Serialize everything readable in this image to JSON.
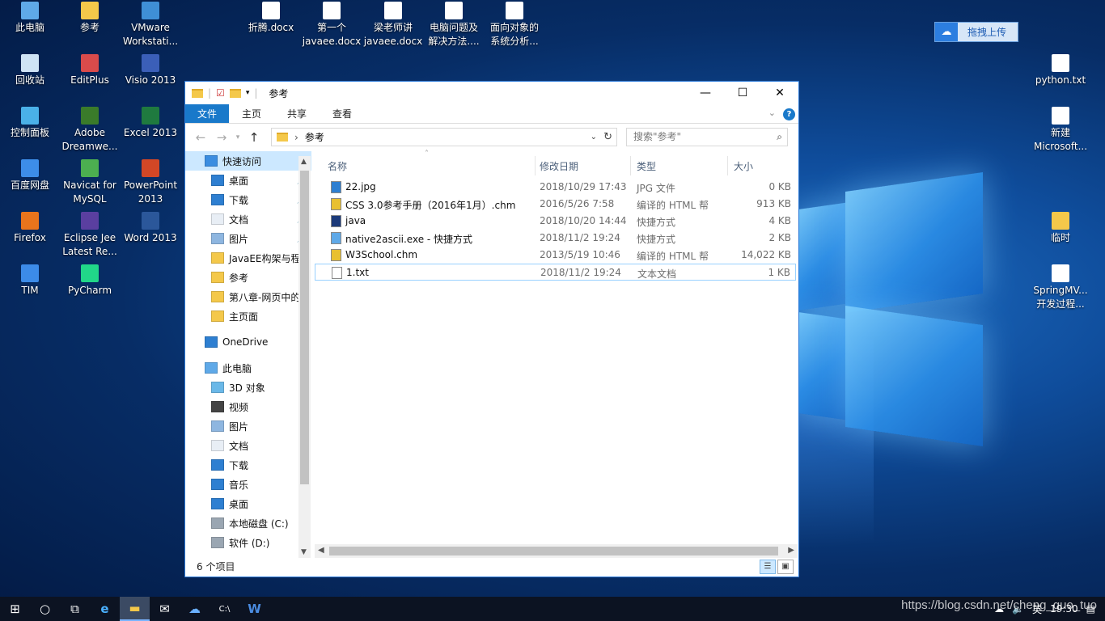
{
  "desktop": {
    "icons": [
      {
        "label": "此电脑",
        "icon": "computer-icon"
      },
      {
        "label": "参考",
        "icon": "folder-icon"
      },
      {
        "label": "VMware Workstati...",
        "icon": "vmware-icon"
      },
      {
        "label": "折腾.docx",
        "icon": "word-doc-icon"
      },
      {
        "label": "第一个 javaee.docx",
        "icon": "word-doc-icon"
      },
      {
        "label": "梁老师讲 javaee.docx",
        "icon": "word-doc-icon"
      },
      {
        "label": "电脑问题及 解决方法....",
        "icon": "word-doc-icon"
      },
      {
        "label": "面向对象的 系统分析...",
        "icon": "word-doc-icon"
      },
      {
        "label": "回收站",
        "icon": "recycle-bin-icon"
      },
      {
        "label": "EditPlus",
        "icon": "editplus-icon"
      },
      {
        "label": "Visio 2013",
        "icon": "visio-icon"
      },
      {
        "label": "控制面板",
        "icon": "control-panel-icon"
      },
      {
        "label": "Adobe Dreamwe...",
        "icon": "dreamweaver-icon"
      },
      {
        "label": "Excel 2013",
        "icon": "excel-icon"
      },
      {
        "label": "百度网盘",
        "icon": "baidu-netdisk-icon"
      },
      {
        "label": "Navicat for MySQL",
        "icon": "navicat-icon"
      },
      {
        "label": "PowerPoint 2013",
        "icon": "powerpoint-icon"
      },
      {
        "label": "Firefox",
        "icon": "firefox-icon"
      },
      {
        "label": "Eclipse Jee Latest Re...",
        "icon": "eclipse-icon"
      },
      {
        "label": "Word 2013",
        "icon": "word-icon"
      },
      {
        "label": "TIM",
        "icon": "tim-icon"
      },
      {
        "label": "PyCharm",
        "icon": "pycharm-icon"
      },
      {
        "label": "python.txt",
        "icon": "text-file-icon"
      },
      {
        "label": "新建 Microsoft...",
        "icon": "powerpoint-doc-icon"
      },
      {
        "label": "临时",
        "icon": "folder-icon"
      },
      {
        "label": "SpringMV... 开发过程...",
        "icon": "word-doc-icon"
      }
    ],
    "baidu_upload": "拖拽上传"
  },
  "window": {
    "title": "参考",
    "controls": {
      "minimize": "—",
      "maximize": "☐",
      "close": "✕"
    },
    "ribbon_tabs": [
      "文件",
      "主页",
      "共享",
      "查看"
    ],
    "address_path": "参考",
    "search_placeholder": "搜索\"参考\"",
    "nav": [
      {
        "label": "快速访问",
        "icon": "star-icon",
        "level": 0
      },
      {
        "label": "桌面",
        "icon": "desktop-icon",
        "level": 1
      },
      {
        "label": "下载",
        "icon": "download-icon",
        "level": 1
      },
      {
        "label": "文档",
        "icon": "document-icon",
        "level": 1
      },
      {
        "label": "图片",
        "icon": "pictures-icon",
        "level": 1
      },
      {
        "label": "JavaEE构架与程",
        "icon": "folder-icon",
        "level": 1
      },
      {
        "label": "参考",
        "icon": "folder-icon",
        "level": 1
      },
      {
        "label": "第八章-网页中的",
        "icon": "folder-icon",
        "level": 1
      },
      {
        "label": "主页面",
        "icon": "folder-icon",
        "level": 1
      },
      {
        "label": "OneDrive",
        "icon": "onedrive-icon",
        "level": 0
      },
      {
        "label": "此电脑",
        "icon": "computer-icon",
        "level": 0
      },
      {
        "label": "3D 对象",
        "icon": "3d-objects-icon",
        "level": 1
      },
      {
        "label": "视频",
        "icon": "video-icon",
        "level": 1
      },
      {
        "label": "图片",
        "icon": "pictures-icon",
        "level": 1
      },
      {
        "label": "文档",
        "icon": "document-icon",
        "level": 1
      },
      {
        "label": "下载",
        "icon": "download-icon",
        "level": 1
      },
      {
        "label": "音乐",
        "icon": "music-icon",
        "level": 1
      },
      {
        "label": "桌面",
        "icon": "desktop-icon",
        "level": 1
      },
      {
        "label": "本地磁盘 (C:)",
        "icon": "drive-icon",
        "level": 1
      },
      {
        "label": "软件 (D:)",
        "icon": "drive-icon",
        "level": 1
      }
    ],
    "columns": {
      "name": "名称",
      "date": "修改日期",
      "type": "类型",
      "size": "大小"
    },
    "files": [
      {
        "name": "22.jpg",
        "date": "2018/10/29 17:43",
        "type": "JPG 文件",
        "size": "0 KB",
        "icon": "image-file-icon"
      },
      {
        "name": "CSS 3.0参考手册（2016年1月）.chm",
        "date": "2016/5/26 7:58",
        "type": "编译的 HTML 帮",
        "size": "913 KB",
        "icon": "chm-file-icon"
      },
      {
        "name": "java",
        "date": "2018/10/20 14:44",
        "type": "快捷方式",
        "size": "4 KB",
        "icon": "java-shortcut-icon"
      },
      {
        "name": "native2ascii.exe - 快捷方式",
        "date": "2018/11/2 19:24",
        "type": "快捷方式",
        "size": "2 KB",
        "icon": "exe-shortcut-icon"
      },
      {
        "name": "W3School.chm",
        "date": "2013/5/19 10:46",
        "type": "编译的 HTML 帮",
        "size": "14,022 KB",
        "icon": "chm-file-icon"
      },
      {
        "name": "1.txt",
        "date": "2018/11/2 19:24",
        "type": "文本文档",
        "size": "1 KB",
        "icon": "text-file-icon"
      }
    ],
    "status": "6 个项目"
  },
  "taskbar": {
    "time": "19:30",
    "ime": "英",
    "watermark": "https://blog.csdn.net/cheng_guo_tuo"
  },
  "colors": {
    "accent": "#1979ca",
    "selection": "#cce8ff"
  }
}
